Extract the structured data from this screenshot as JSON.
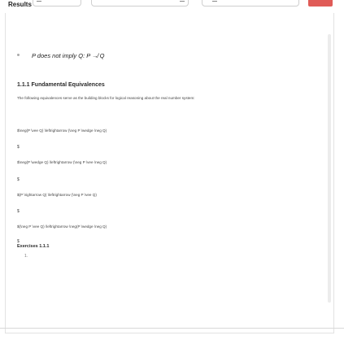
{
  "topbar": {
    "title": "Results"
  },
  "main": {
    "bullet": "P does not imply Q: P ↛ Q",
    "section_title": "1.1.1 Fundamental Equivalences",
    "intro": "The following equivalences serve as the building blocks for logical reasoning about the real number system:",
    "lines": [
      "$\\neg(P \\vee Q) \\leftrightarrow (\\neg P \\wedge \\neg Q)",
      "$",
      "$\\neg(P \\wedge Q) \\leftrightarrow (\\neg P \\vee \\neg Q)",
      "$",
      "$(P \\rightarrow Q) \\leftrightarrow (\\neg P \\vee Q)",
      "$",
      "$(\\neg P \\vee Q) \\leftrightarrow \\neg(P \\wedge \\neg Q)",
      "$"
    ],
    "exercises_title": "Exercises 1.1.1",
    "exercise_number": "1."
  }
}
